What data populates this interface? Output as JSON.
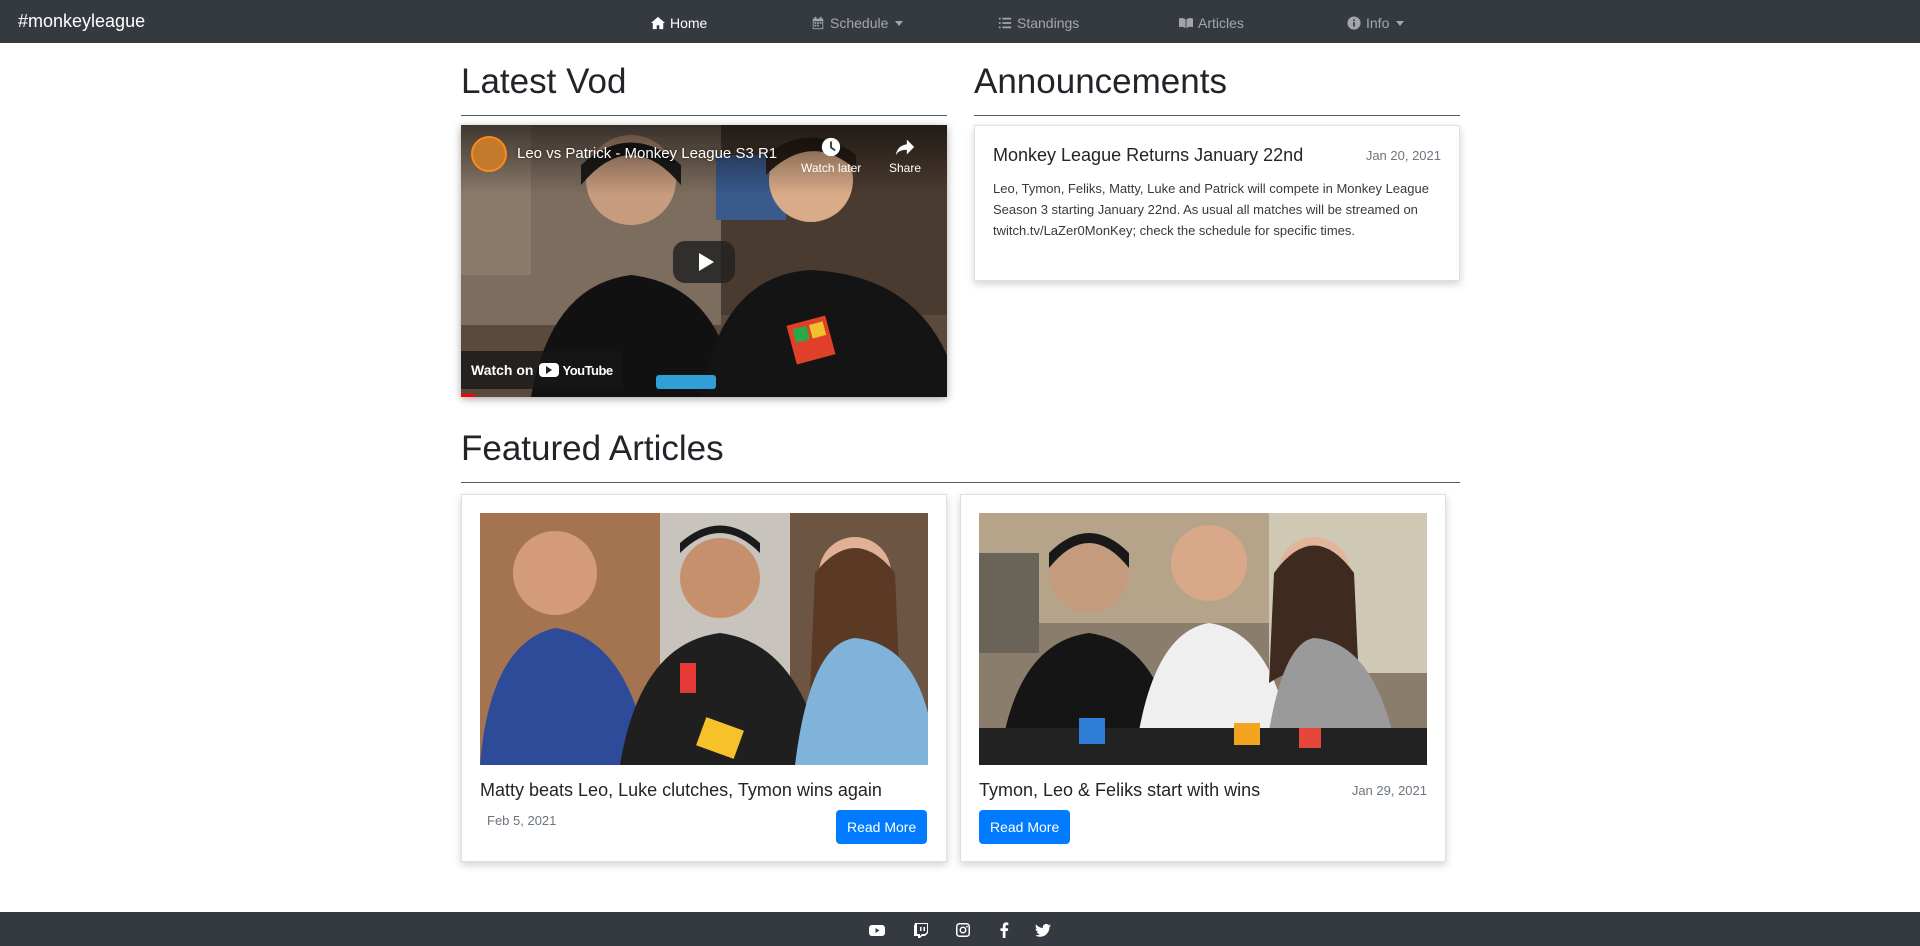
{
  "nav": {
    "brand": "#monkeyleague",
    "items": [
      {
        "label": "Home",
        "icon": "home-icon",
        "active": true
      },
      {
        "label": "Schedule",
        "icon": "calendar-icon",
        "dropdown": true
      },
      {
        "label": "Standings",
        "icon": "list-icon"
      },
      {
        "label": "Articles",
        "icon": "book-icon"
      },
      {
        "label": "Info",
        "icon": "info-icon",
        "dropdown": true
      }
    ]
  },
  "vod": {
    "heading": "Latest Vod",
    "video_title": "Leo vs Patrick - Monkey League S3 R1",
    "watch_later": "Watch later",
    "share": "Share",
    "watch_on": "Watch on",
    "youtube": "YouTube"
  },
  "announcements": {
    "heading": "Announcements",
    "items": [
      {
        "title": "Monkey League Returns January 22nd",
        "date": "Jan 20, 2021",
        "body": "Leo, Tymon, Feliks, Matty, Luke and Patrick will compete in Monkey League Season 3 starting January 22nd. As usual all matches will be streamed on twitch.tv/LaZer0MonKey; check the schedule for specific times."
      }
    ]
  },
  "featured": {
    "heading": "Featured Articles",
    "articles": [
      {
        "title": "Matty beats Leo, Luke clutches, Tymon wins again",
        "date": "Feb 5, 2021",
        "button": "Read More"
      },
      {
        "title": "Tymon, Leo & Feliks start with wins",
        "date": "Jan 29, 2021",
        "button": "Read More"
      }
    ]
  },
  "footer": {
    "icons": [
      "youtube-icon",
      "twitch-icon",
      "instagram-icon",
      "facebook-icon",
      "twitter-icon"
    ]
  },
  "colors": {
    "navbar": "#343a40",
    "primary_button": "#007bff",
    "muted_text": "#6c757d"
  }
}
